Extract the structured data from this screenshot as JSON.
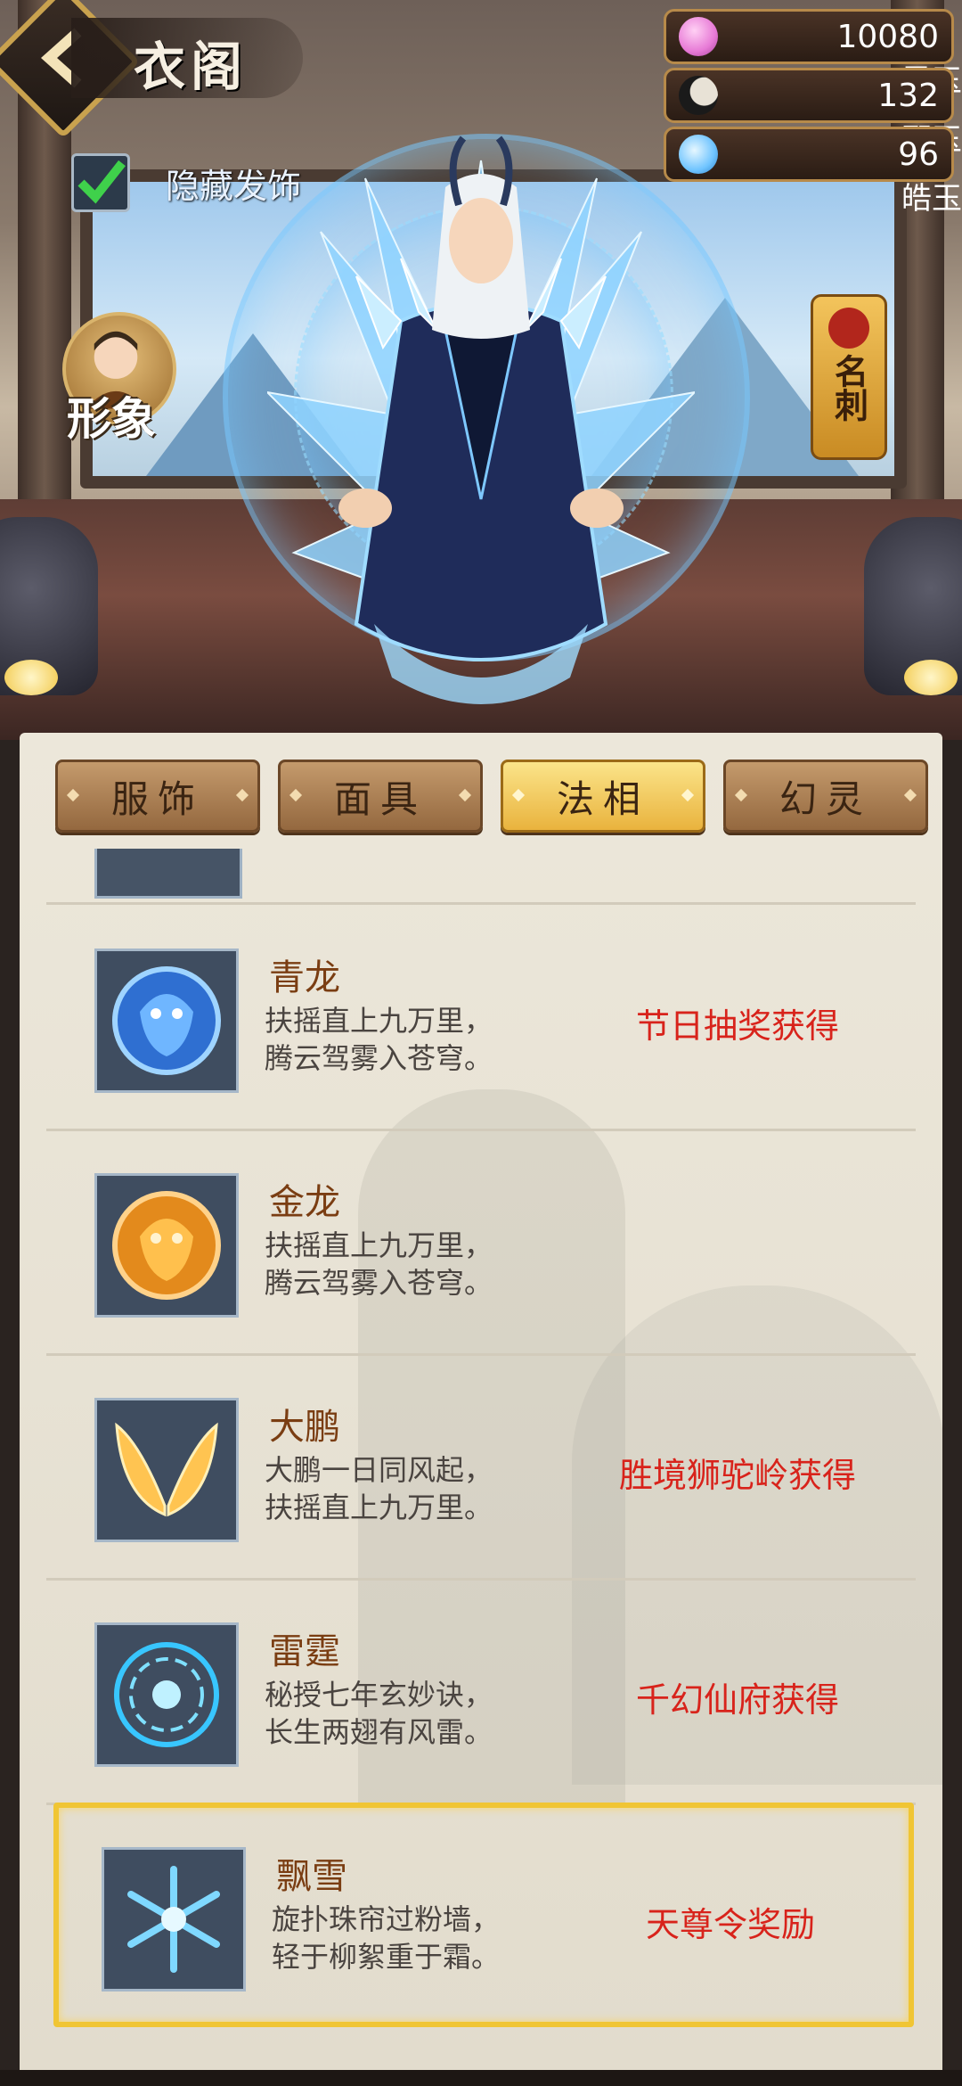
{
  "header": {
    "title": "衣阁",
    "hide_label": "隐藏发饰",
    "hide_checked": true
  },
  "currencies": [
    {
      "name": "灵玉",
      "value": "10080",
      "icon": "pink-gem-icon",
      "color": "#e77ad6"
    },
    {
      "name": "邪玉",
      "value": "132",
      "icon": "dark-moon-icon",
      "color": "#1a1a1a"
    },
    {
      "name": "皓玉",
      "value": "96",
      "icon": "blue-swirl-icon",
      "color": "#6fc4ff"
    }
  ],
  "side_buttons": {
    "appearance_label": "形象",
    "card_label": "名刺"
  },
  "tabs": [
    {
      "label": "服饰",
      "active": false
    },
    {
      "label": "面具",
      "active": false
    },
    {
      "label": "法相",
      "active": true
    },
    {
      "label": "幻灵",
      "active": false
    }
  ],
  "items": [
    {
      "name": "青龙",
      "desc1": "扶摇直上九万里，",
      "desc2": "腾云驾雾入苍穹。",
      "source": "节日抽奖获得",
      "icon": "blue-dragon-icon",
      "selected": false
    },
    {
      "name": "金龙",
      "desc1": "扶摇直上九万里，",
      "desc2": "腾云驾雾入苍穹。",
      "source": "",
      "icon": "gold-dragon-icon",
      "selected": false
    },
    {
      "name": "大鹏",
      "desc1": "大鹏一日同风起，",
      "desc2": "扶摇直上九万里。",
      "source": "胜境狮驼岭获得",
      "icon": "golden-wings-icon",
      "selected": false
    },
    {
      "name": "雷霆",
      "desc1": "秘授七年玄妙诀，",
      "desc2": "长生两翅有风雷。",
      "source": "千幻仙府获得",
      "icon": "thunder-ring-icon",
      "selected": false
    },
    {
      "name": "飘雪",
      "desc1": "旋扑珠帘过粉墙，",
      "desc2": "轻于柳絮重于霜。",
      "source": "天尊令奖励",
      "icon": "snowflake-icon",
      "selected": true
    }
  ],
  "colors": {
    "accent_gold": "#f0c534",
    "source_red": "#d8231b",
    "item_name_brown": "#7a3d12"
  }
}
